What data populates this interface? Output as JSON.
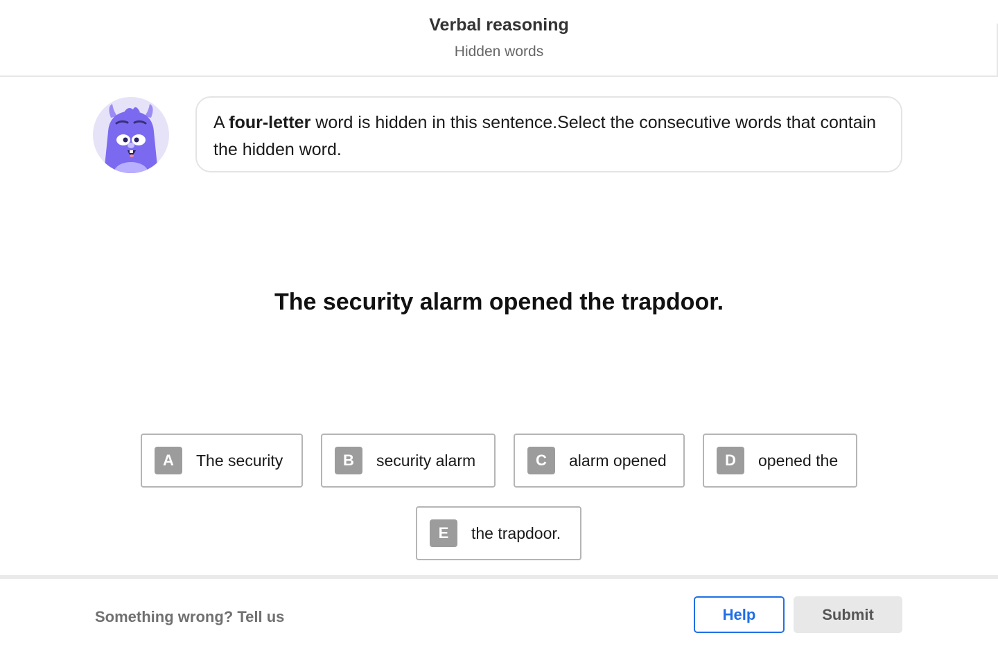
{
  "header": {
    "title": "Verbal reasoning",
    "subtitle": "Hidden words"
  },
  "mascot": {
    "icon": "purple-monster-mascot",
    "color": "#7b6af0",
    "background": "#e6e3f8"
  },
  "instruction": {
    "prefix": "A ",
    "emphasis": "four-letter",
    "suffix": " word is hidden in this sentence.Select the consecutive words that contain the hidden word."
  },
  "question": {
    "sentence": "The security alarm opened the trapdoor."
  },
  "options": [
    {
      "letter": "A",
      "label": "The security"
    },
    {
      "letter": "B",
      "label": "security alarm"
    },
    {
      "letter": "C",
      "label": "alarm opened"
    },
    {
      "letter": "D",
      "label": "opened the"
    },
    {
      "letter": "E",
      "label": "the trapdoor."
    }
  ],
  "footer": {
    "report_link": "Something wrong? Tell us",
    "help_label": "Help",
    "submit_label": "Submit"
  },
  "colors": {
    "accent": "#1f6fe5",
    "option_badge": "#9c9c9c",
    "submit_bg": "#e8e8e8"
  }
}
